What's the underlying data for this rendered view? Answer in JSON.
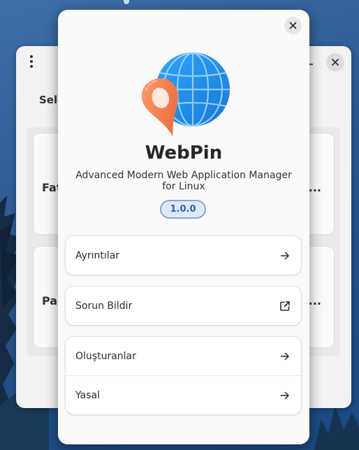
{
  "background_window": {
    "heading": "Sele",
    "cards": [
      {
        "title": "Fat",
        "more": "..."
      },
      {
        "title": "Par",
        "more": "i..."
      }
    ]
  },
  "dialog": {
    "app_name": "WebPin",
    "description": "Advanced Modern Web Application Manager for Linux",
    "version": "1.0.0",
    "groups": [
      {
        "rows": [
          {
            "label": "Ayrıntılar",
            "icon": "arrow-right-icon"
          }
        ]
      },
      {
        "rows": [
          {
            "label": "Sorun Bildir",
            "icon": "external-link-icon"
          }
        ]
      },
      {
        "rows": [
          {
            "label": "Oluşturanlar",
            "icon": "arrow-right-icon"
          },
          {
            "label": "Yasal",
            "icon": "arrow-right-icon"
          }
        ]
      }
    ]
  },
  "colors": {
    "accent": "#2a62b6",
    "badge_bg": "#dfe9f6",
    "globe": "#1e90ee",
    "pin": "#f47a52"
  }
}
